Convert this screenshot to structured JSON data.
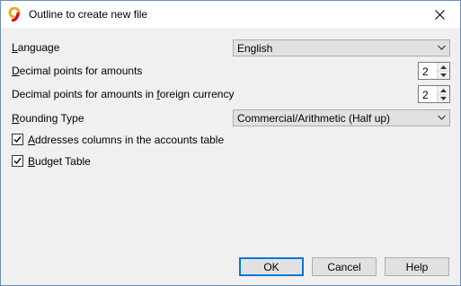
{
  "window": {
    "title": "Outline to create new file"
  },
  "fields": {
    "language": {
      "label": "Language",
      "value": "English"
    },
    "decimal_amounts": {
      "label": "Decimal points for amounts",
      "value": "2"
    },
    "decimal_foreign": {
      "label": "Decimal points for amounts in foreign currency",
      "value": "2"
    },
    "rounding": {
      "label": "Rounding Type",
      "value": "Commercial/Arithmetic (Half up)"
    }
  },
  "checkboxes": {
    "addresses": {
      "label": "Addresses columns in the accounts table",
      "checked": true
    },
    "budget": {
      "label": "Budget Table",
      "checked": true
    }
  },
  "buttons": {
    "ok": "OK",
    "cancel": "Cancel",
    "help": "Help"
  },
  "icons": {
    "app": "app-logo-icon",
    "close": "close-icon",
    "dropdown": "chevron-down-icon",
    "spin_up": "spin-up-icon",
    "spin_down": "spin-down-icon",
    "check": "checkmark-icon"
  },
  "colors": {
    "accent": "#0078d7",
    "logo_orange": "#f5a623",
    "logo_red": "#d0021b"
  }
}
